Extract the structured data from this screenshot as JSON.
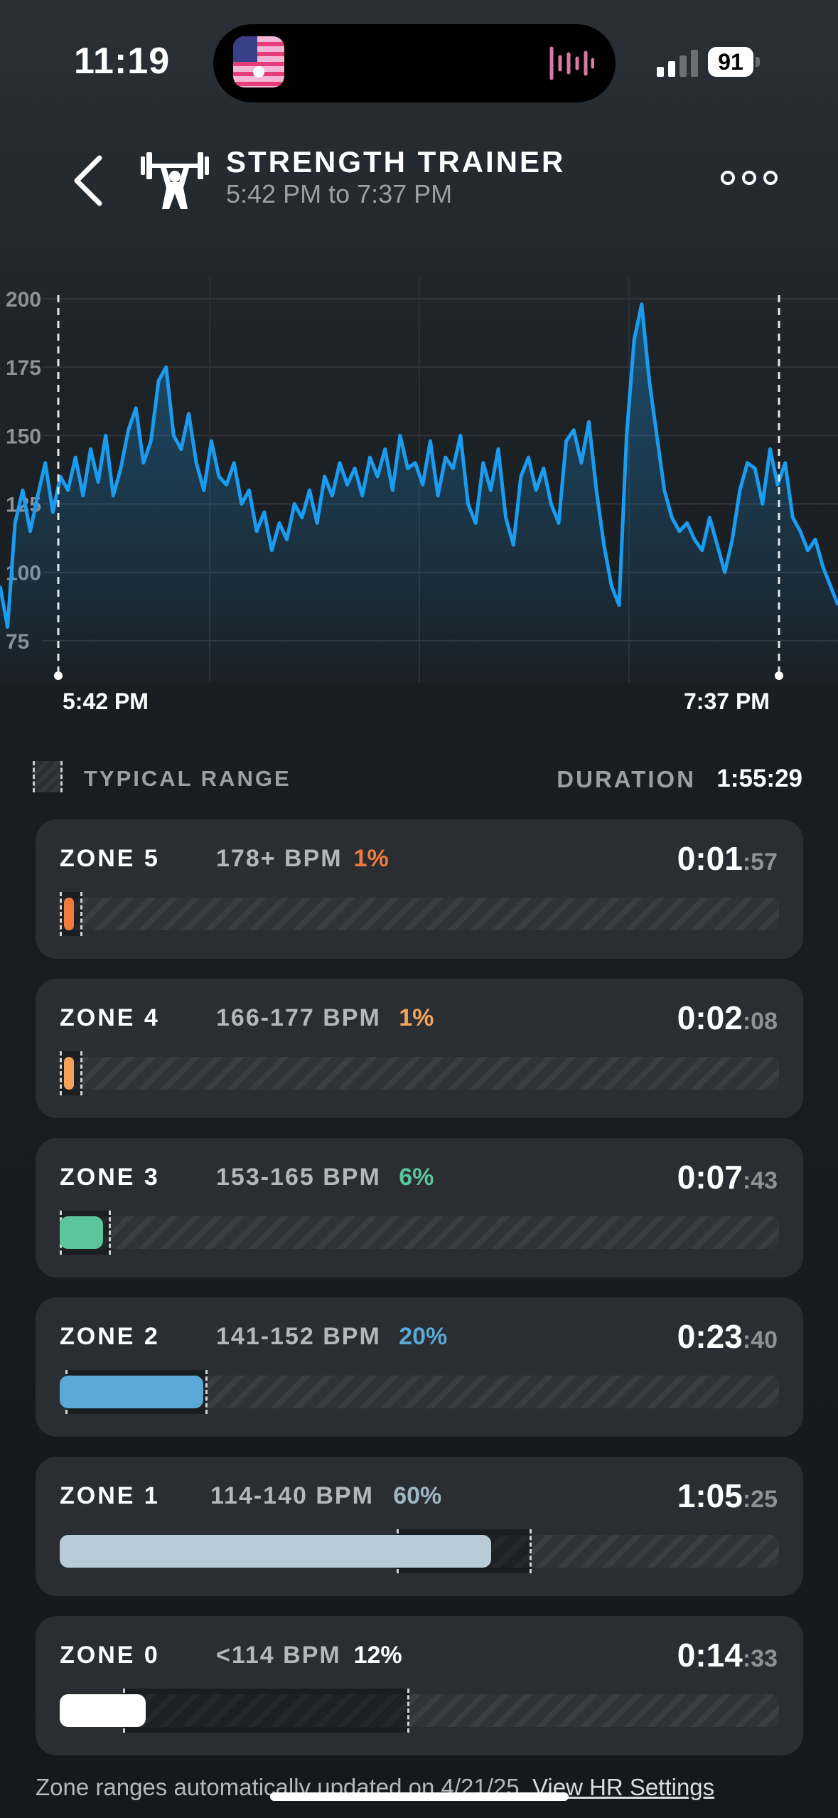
{
  "status_bar": {
    "time": "11:19",
    "battery": "91"
  },
  "header": {
    "title": "STRENGTH TRAINER",
    "subtitle": "5:42 PM to 7:37 PM"
  },
  "chart_data": {
    "type": "line",
    "title": "",
    "xlabel": "",
    "ylabel": "",
    "y_ticks": [
      "200",
      "175",
      "150",
      "125",
      "100",
      "75"
    ],
    "ylim": [
      75,
      200
    ],
    "x_labels": {
      "start": "5:42 PM",
      "end": "7:37 PM"
    },
    "grid": true,
    "series": [
      {
        "color": "#1a9cf0",
        "values": [
          95,
          80,
          118,
          130,
          115,
          128,
          140,
          122,
          135,
          130,
          142,
          128,
          145,
          133,
          150,
          128,
          138,
          152,
          160,
          140,
          148,
          170,
          175,
          150,
          145,
          158,
          140,
          130,
          148,
          135,
          132,
          140,
          125,
          130,
          115,
          122,
          108,
          118,
          112,
          125,
          120,
          130,
          118,
          135,
          128,
          140,
          132,
          138,
          128,
          142,
          135,
          145,
          130,
          150,
          138,
          140,
          132,
          148,
          128,
          142,
          138,
          150,
          125,
          118,
          140,
          130,
          145,
          120,
          110,
          135,
          142,
          130,
          138,
          125,
          118,
          148,
          152,
          140,
          155,
          130,
          110,
          95,
          88,
          150,
          185,
          198,
          170,
          150,
          130,
          120,
          115,
          118,
          112,
          108,
          120,
          110,
          100,
          112,
          130,
          140,
          138,
          125,
          145,
          132,
          140,
          120,
          115,
          108,
          112,
          102,
          95,
          88
        ]
      }
    ]
  },
  "summary": {
    "typical_label": "TYPICAL RANGE",
    "duration_label": "DURATION",
    "duration_value": "1:55:29"
  },
  "zones": [
    {
      "name": "ZONE 5",
      "bpm": "178+ BPM",
      "pct": "1%",
      "time_main": "0:01",
      "time_sec": ":57",
      "color": "#f07a3c",
      "fill": 0.01,
      "typ_start": 0.0,
      "typ_end": 0.01
    },
    {
      "name": "ZONE 4",
      "bpm": "166-177 BPM",
      "pct": "1%",
      "time_main": "0:02",
      "time_sec": ":08",
      "color": "#f5a35a",
      "fill": 0.01,
      "typ_start": 0.0,
      "typ_end": 0.01
    },
    {
      "name": "ZONE 3",
      "bpm": "153-165 BPM",
      "pct": "6%",
      "time_main": "0:07",
      "time_sec": ":43",
      "color": "#5cc59a",
      "fill": 0.06,
      "typ_start": 0.0,
      "typ_end": 0.065
    },
    {
      "name": "ZONE 2",
      "bpm": "141-152 BPM",
      "pct": "20%",
      "time_main": "0:23",
      "time_sec": ":40",
      "color": "#5aa8d6",
      "fill": 0.2,
      "typ_start": 0.02,
      "typ_end": 0.2
    },
    {
      "name": "ZONE 1",
      "bpm": "114-140 BPM",
      "pct": "60%",
      "time_main": "1:05",
      "time_sec": ":25",
      "color": "#b9cbd6",
      "fill": 0.6,
      "typ_start": 0.48,
      "typ_end": 0.65
    },
    {
      "name": "ZONE 0",
      "bpm": "<114 BPM",
      "pct": "12%",
      "time_main": "0:14",
      "time_sec": ":33",
      "color": "#ffffff",
      "fill": 0.12,
      "typ_start": 0.1,
      "typ_end": 0.48
    }
  ],
  "footer": {
    "text": "Zone ranges automatically updated on 4/21/25.",
    "link": "View HR Settings"
  }
}
